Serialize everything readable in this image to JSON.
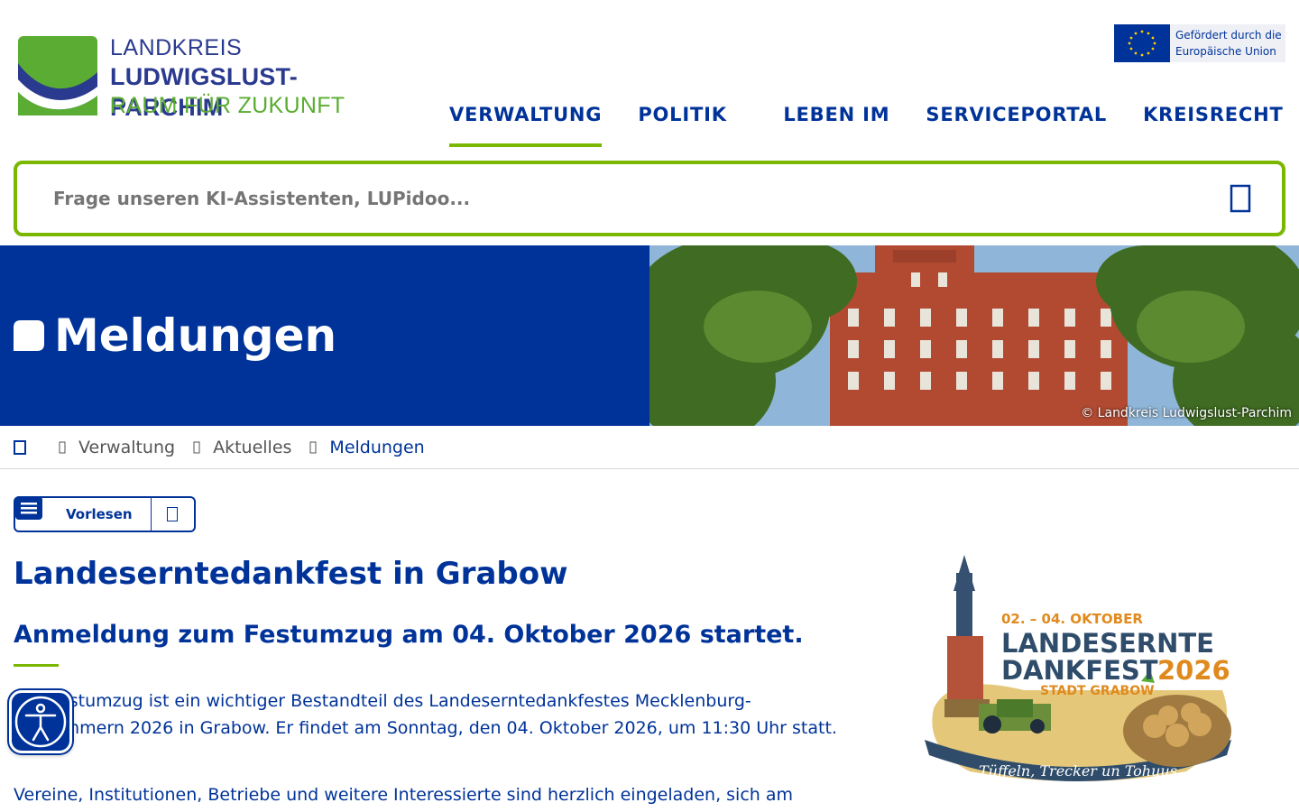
{
  "header": {
    "logo": {
      "line1": "LANDKREIS",
      "line2": "LUDWIGSLUST-PARCHIM",
      "line3": "RAUM FÜR ZUKUNFT"
    },
    "eu_badge": {
      "line1": "Gefördert durch die",
      "line2": "Europäische Union"
    },
    "nav": [
      {
        "label": "VERWALTUNG",
        "active": true
      },
      {
        "label": "POLITIK",
        "active": false
      },
      {
        "label": "LEBEN IM",
        "active": false
      },
      {
        "label": "SERVICEPORTAL",
        "active": false
      },
      {
        "label": "KREISRECHT",
        "active": false
      }
    ]
  },
  "search": {
    "placeholder": "Frage unseren KI-Assistenten, LUPidoo...",
    "icon": "search-icon"
  },
  "hero": {
    "title": "Meldungen",
    "image_credit": "© Landkreis Ludwigslust-Parchim"
  },
  "breadcrumb": {
    "items": [
      "Verwaltung",
      "Aktuelles",
      "Meldungen"
    ]
  },
  "reader": {
    "label": "Vorlesen"
  },
  "article": {
    "title": "Landeserntedankfest in Grabow",
    "subtitle": "Anmeldung zum Festumzug am 04. Oktober 2026 startet.",
    "paragraph1": "Der Festumzug ist ein wichtiger Bestandteil des Landeserntedankfestes Mecklenburg-Vorpommern 2026 in Grabow. Er findet am Sonntag, den 04. Oktober 2026, um 11:30 Uhr statt.",
    "paragraph2": "Vereine, Institutionen, Betriebe und weitere Interessierte sind herzlich eingeladen, sich am"
  },
  "festival_logo": {
    "date": "02. – 04. OKTOBER",
    "name1": "LANDESERNTE",
    "name2": "DANKFEST",
    "year": "2026",
    "town": "STADT GRABOW",
    "slogan": "Tüffeln, Trecker un Tohuus"
  },
  "colors": {
    "primary": "#003399",
    "accent": "#7ab800"
  }
}
